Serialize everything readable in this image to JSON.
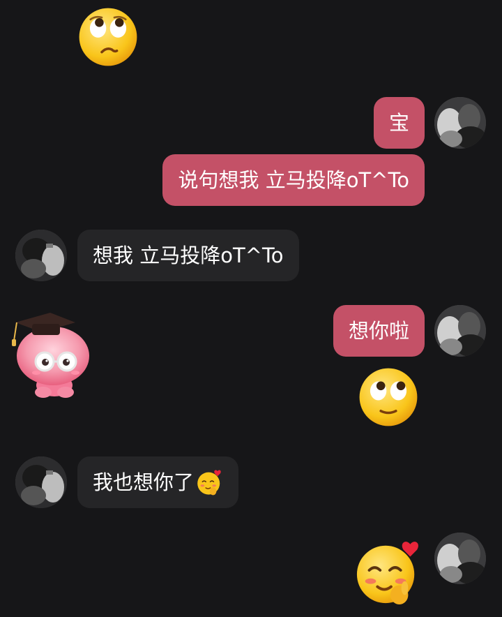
{
  "messages": [
    {
      "side": "received",
      "type": "emoji",
      "icon": "rolling-eyes-emoji"
    },
    {
      "side": "sent",
      "type": "text",
      "text": "宝"
    },
    {
      "side": "sent",
      "type": "text",
      "text": "说句想我 立马投降oT^To"
    },
    {
      "side": "received",
      "type": "text",
      "text": "想我 立马投降oT^To"
    },
    {
      "side": "received",
      "type": "sticker",
      "icon": "graduation-mascot-sticker"
    },
    {
      "side": "sent",
      "type": "text",
      "text": "想你啦"
    },
    {
      "side": "sent",
      "type": "emoji",
      "icon": "rolling-eyes-emoji"
    },
    {
      "side": "received",
      "type": "text",
      "text": "我也想你了",
      "trailing_icon": "blushing-heart-emoji"
    },
    {
      "side": "sent",
      "type": "emoji",
      "icon": "blushing-heart-emoji"
    }
  ],
  "colors": {
    "background": "#161618",
    "sent_bubble": "#c45167",
    "received_bubble": "#252527",
    "text": "#ffffff"
  }
}
